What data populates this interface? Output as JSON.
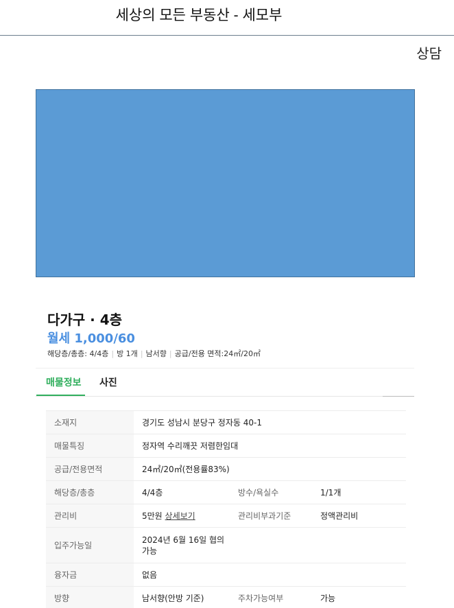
{
  "header": {
    "title": "세상의 모든 부동산  - 세모부",
    "consult_label": "상담"
  },
  "listing": {
    "type_label": "다가구 · 4층",
    "price_label": "월세 1,000/60",
    "summary": {
      "floor": "해당층/총층: 4/4층",
      "rooms": "방 1개",
      "direction": "남서향",
      "area": "공급/전용 면적:24㎡/20㎡"
    }
  },
  "tabs": {
    "info": "매물정보",
    "photos": "사진"
  },
  "details": {
    "location_label": "소재지",
    "location_value": "경기도 성남시 분당구 정자동 40-1",
    "feature_label": "매물특징",
    "feature_value": "정자역 수리깨끗 저렴한임대",
    "area_label": "공급/전용면적",
    "area_value": "24㎡/20㎡(전용률83%)",
    "floor_label": "해당층/총층",
    "floor_value": "4/4층",
    "rooms_label": "방수/욕실수",
    "rooms_value": "1/1개",
    "fee_label": "관리비",
    "fee_value": "5만원",
    "fee_link": "상세보기",
    "fee_basis_label": "관리비부과기준",
    "fee_basis_value": "정액관리비",
    "movein_label": "입주가능일",
    "movein_value_line1": "2024년 6월 16일 협의",
    "movein_value_line2": "가능",
    "loan_label": "융자금",
    "loan_value": "없음",
    "direction_label": "방향",
    "direction_value": "남서향(안방 기준)",
    "parking_label": "주차가능여부",
    "parking_value": "가능"
  }
}
